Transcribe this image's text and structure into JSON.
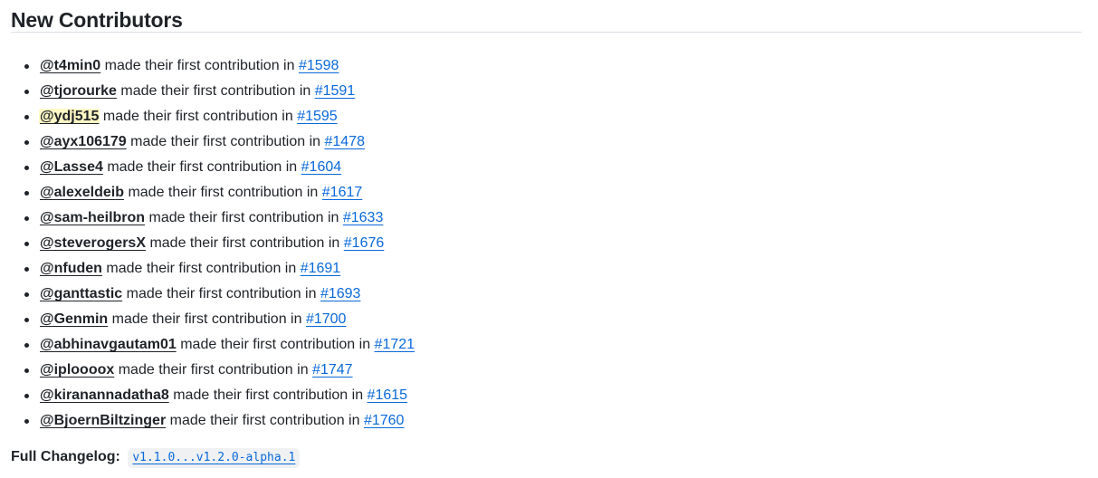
{
  "heading": "New Contributors",
  "item_text": "made their first contribution in",
  "contributors": [
    {
      "user": "@t4min0",
      "pr": "#1598",
      "highlighted": false
    },
    {
      "user": "@tjorourke",
      "pr": "#1591",
      "highlighted": false
    },
    {
      "user": "@ydj515",
      "pr": "#1595",
      "highlighted": true
    },
    {
      "user": "@ayx106179",
      "pr": "#1478",
      "highlighted": false
    },
    {
      "user": "@Lasse4",
      "pr": "#1604",
      "highlighted": false
    },
    {
      "user": "@alexeldeib",
      "pr": "#1617",
      "highlighted": false
    },
    {
      "user": "@sam-heilbron",
      "pr": "#1633",
      "highlighted": false
    },
    {
      "user": "@steverogersX",
      "pr": "#1676",
      "highlighted": false
    },
    {
      "user": "@nfuden",
      "pr": "#1691",
      "highlighted": false
    },
    {
      "user": "@ganttastic",
      "pr": "#1693",
      "highlighted": false
    },
    {
      "user": "@Genmin",
      "pr": "#1700",
      "highlighted": false
    },
    {
      "user": "@abhinavgautam01",
      "pr": "#1721",
      "highlighted": false
    },
    {
      "user": "@iploooox",
      "pr": "#1747",
      "highlighted": false
    },
    {
      "user": "@kiranannadatha8",
      "pr": "#1615",
      "highlighted": false
    },
    {
      "user": "@BjoernBiltzinger",
      "pr": "#1760",
      "highlighted": false
    }
  ],
  "changelog": {
    "label": "Full Changelog:",
    "link": "v1.1.0...v1.2.0-alpha.1"
  },
  "colors": {
    "text": "#1f2328",
    "link": "#0969da",
    "highlight": "#fff8c5",
    "code_bg": "#eff1f3",
    "divider": "#d8dee4"
  }
}
